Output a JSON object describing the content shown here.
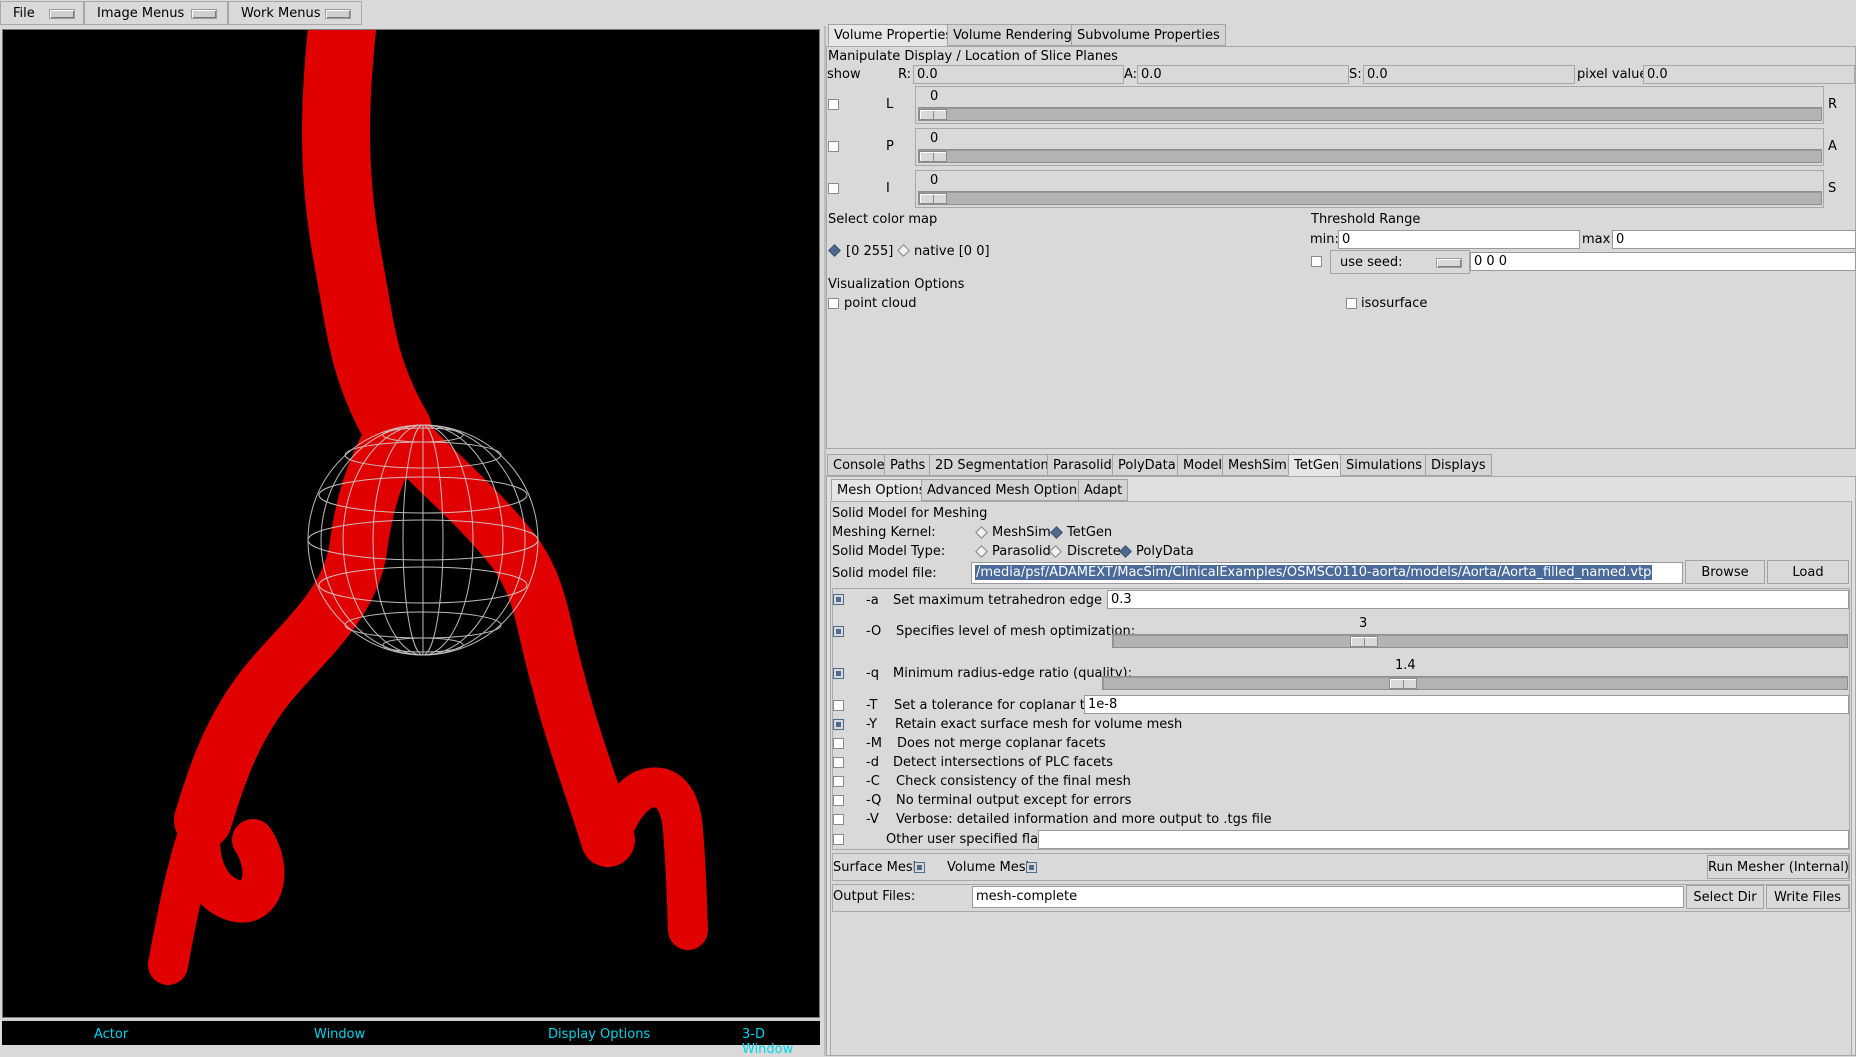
{
  "menubar": {
    "file": "File",
    "image_menus": "Image Menus",
    "work_menus": "Work Menus"
  },
  "viewport": {
    "status": {
      "actor": "Actor",
      "window": "Window",
      "display_options": "Display Options",
      "view_3d": "3-D Window"
    },
    "colors": {
      "background": "#000000",
      "vessel": "#e00000",
      "wireframe": "#d0d0d0",
      "status_text": "#00d4e8"
    }
  },
  "top_tabs": [
    "Volume Properties",
    "Volume Rendering",
    "Subvolume Properties"
  ],
  "volume": {
    "section_title": "Manipulate Display / Location of Slice Planes",
    "show_label": "show",
    "r_label": "R:",
    "r_value": "0.0",
    "a_label": "A:",
    "a_value": "0.0",
    "s_label": "S:",
    "s_value": "0.0",
    "pixel_label": "pixel value:",
    "pixel_value": "0.0",
    "sliders": [
      {
        "left": "L",
        "right": "R",
        "value": "0"
      },
      {
        "left": "P",
        "right": "A",
        "value": "0"
      },
      {
        "left": "I",
        "right": "S",
        "value": "0"
      }
    ],
    "color_map_title": "Select color map",
    "color_map_options": [
      "[0 255]",
      "native [0 0]"
    ],
    "threshold_title": "Threshold Range",
    "min_label": "min:",
    "min_value": "0",
    "max_label": "max:",
    "max_value": "0",
    "use_seed_label": "use seed:",
    "seed_value": "0 0 0",
    "vis_title": "Visualization Options",
    "point_cloud": "point cloud",
    "isosurface": "isosurface"
  },
  "bottom_tabs": [
    "Console",
    "Paths",
    "2D Segmentation",
    "Parasolid",
    "PolyData",
    "Model",
    "MeshSim",
    "TetGen",
    "Simulations",
    "Displays"
  ],
  "sub_tabs": [
    "Mesh Options",
    "Advanced Mesh Options",
    "Adapt"
  ],
  "mesh": {
    "solid_model_title": "Solid Model for Meshing",
    "kernel_label": "Meshing Kernel:",
    "kernel_options": [
      "MeshSim",
      "TetGen"
    ],
    "type_label": "Solid Model Type:",
    "type_options": [
      "Parasolid",
      "Discrete",
      "PolyData"
    ],
    "file_label": "Solid model file:",
    "file_value": "/media/psf/ADAMEXT/MacSim/ClinicalExamples/OSMSC0110-aorta/models/Aorta/Aorta_filled_named.vtp",
    "browse": "Browse",
    "load": "Load",
    "opt_a_flag": "-a",
    "opt_a_label": "Set maximum tetrahedron edge size:",
    "opt_a_value": "0.3",
    "opt_o_flag": "-O",
    "opt_o_label": "Specifies level of mesh optimization:",
    "opt_o_value": "3",
    "opt_q_flag": "-q",
    "opt_q_label": "Minimum radius-edge ratio (quality):",
    "opt_q_value": "1.4",
    "opt_t_flag": "-T",
    "opt_t_label": "Set a tolerance for coplanar test:",
    "opt_t_value": "1e-8",
    "flags": [
      {
        "flag": "-Y",
        "label": "Retain exact surface mesh for volume mesh",
        "checked": true
      },
      {
        "flag": "-M",
        "label": "Does not merge coplanar facets",
        "checked": false
      },
      {
        "flag": "-d",
        "label": "Detect intersections of PLC facets",
        "checked": false
      },
      {
        "flag": "-C",
        "label": "Check consistency of the final mesh",
        "checked": false
      },
      {
        "flag": "-Q",
        "label": "No terminal output except for errors",
        "checked": false
      },
      {
        "flag": "-V",
        "label": "Verbose: detailed information and more output to .tgs file",
        "checked": false
      }
    ],
    "other_flags_label": "Other user specified flags:",
    "surface_mesh": "Surface Mesh",
    "volume_mesh": "Volume Mesh",
    "run_mesher": "Run Mesher (Internal)",
    "output_label": "Output Files:",
    "output_value": "mesh-complete",
    "select_dir": "Select Dir",
    "write_files": "Write Files"
  }
}
